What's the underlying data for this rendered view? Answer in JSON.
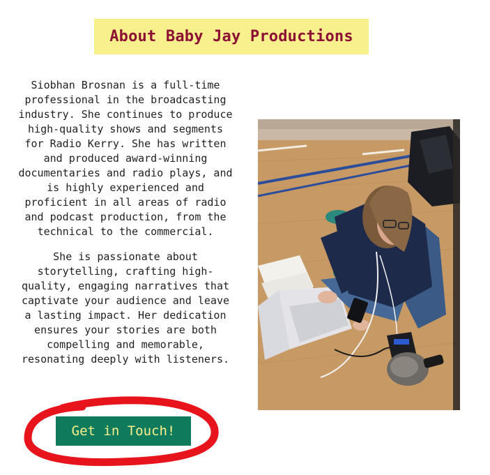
{
  "section": {
    "title": "About Baby Jay Productions"
  },
  "bio": {
    "paragraph1": "Siobhan Brosnan is a full-time professional in the broadcasting industry. She continues to produce high-quality shows and segments for Radio Kerry. She has written and produced award-winning documentaries and radio plays, and is highly experienced and proficient in all areas of radio and podcast production, from the technical to the commercial.",
    "paragraph2": "She is passionate about storytelling, crafting high-quality, engaging narratives that captivate your audience and leave a lasting impact. Her dedication ensures your stories are both compelling and memorable, resonating deeply with listeners."
  },
  "cta": {
    "label": "Get in Touch!"
  },
  "colors": {
    "title_bg": "#f7f08d",
    "title_text": "#8c1033",
    "button_bg": "#0f7a5c",
    "button_text": "#f7f08d",
    "annotation": "#e8141c"
  },
  "photo": {
    "subject": "woman-sitting-on-gym-floor-with-laptop-and-recorder"
  }
}
